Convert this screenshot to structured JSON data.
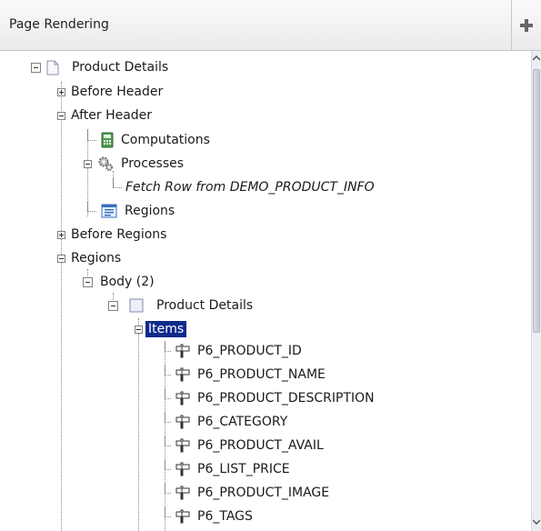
{
  "header": {
    "title": "Page Rendering",
    "add_icon": "plus-icon"
  },
  "tree": {
    "root": "Product Details",
    "before_header": "Before Header",
    "after_header": "After Header",
    "computations": "Computations",
    "processes": "Processes",
    "fetch_row": "Fetch Row from DEMO_PRODUCT_INFO",
    "regions_sub": "Regions",
    "before_regions": "Before Regions",
    "regions": "Regions",
    "body": "Body (2)",
    "product_details_region": "Product Details",
    "items": "Items",
    "item_list": [
      "P6_PRODUCT_ID",
      "P6_PRODUCT_NAME",
      "P6_PRODUCT_DESCRIPTION",
      "P6_CATEGORY",
      "P6_PRODUCT_AVAIL",
      "P6_LIST_PRICE",
      "P6_PRODUCT_IMAGE",
      "P6_TAGS"
    ]
  },
  "colors": {
    "selected_bg": "#102a8c",
    "header_bg": "#f3f3f3"
  }
}
